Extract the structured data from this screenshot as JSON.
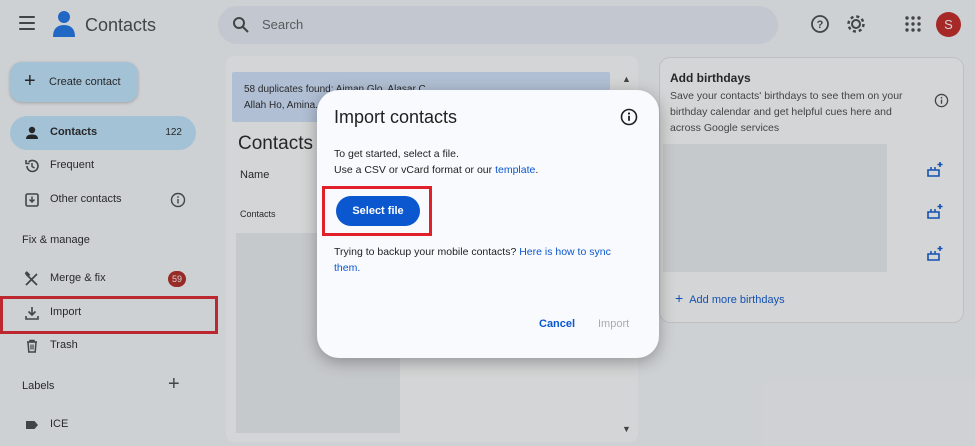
{
  "header": {
    "app_title": "Contacts",
    "search_placeholder": "Search",
    "avatar_initial": "S"
  },
  "sidebar": {
    "create_label": "Create contact",
    "items": [
      {
        "label": "Contacts",
        "count": "122",
        "icon": "person-icon"
      },
      {
        "label": "Frequent",
        "icon": "history-icon"
      },
      {
        "label": "Other contacts",
        "icon": "inbox-download-icon"
      }
    ],
    "fix_manage_heading": "Fix & manage",
    "manage_items": [
      {
        "label": "Merge & fix",
        "badge": "59",
        "icon": "merge-icon"
      },
      {
        "label": "Import",
        "icon": "download-icon"
      },
      {
        "label": "Trash",
        "icon": "trash-icon"
      }
    ],
    "labels_heading": "Labels",
    "labels": [
      {
        "label": "ICE",
        "icon": "label-icon"
      }
    ]
  },
  "main": {
    "duplicates_line1": "58 duplicates found: Aiman Glo, Alasar C...",
    "duplicates_line2": "Allah Ho, Amina...",
    "title": "Contacts",
    "column_name": "Name",
    "group_label": "Contacts"
  },
  "birthdays": {
    "title": "Add birthdays",
    "description": "Save your contacts' birthdays to see them on your birthday calendar and get helpful cues here and across Google services",
    "add_more": "Add more birthdays"
  },
  "dialog": {
    "title": "Import contacts",
    "line1": "To get started, select a file.",
    "line2_prefix": "Use a CSV or vCard format or our ",
    "line2_link": "template",
    "line2_suffix": ".",
    "select_file": "Select file",
    "backup_prefix": "Trying to backup your mobile contacts? ",
    "backup_link_1": "Here is how to sync",
    "backup_link_2": "them.",
    "cancel": "Cancel",
    "import": "Import"
  },
  "colors": {
    "accent": "#0b57d0",
    "active_nav": "#c2e7ff",
    "highlight": "#e0212b",
    "badge": "#b3261e"
  }
}
